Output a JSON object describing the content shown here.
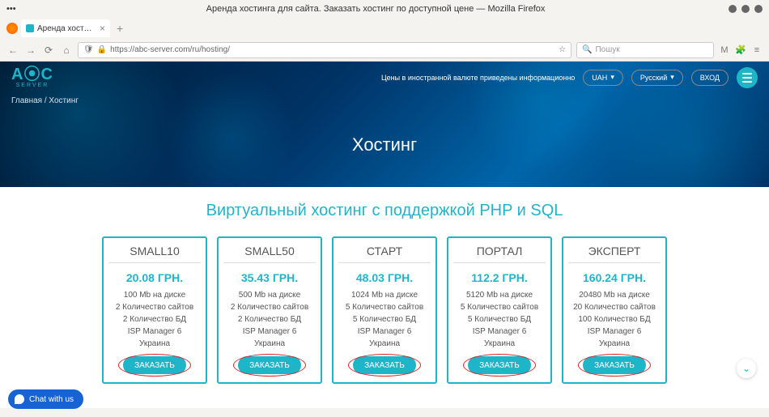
{
  "sys": {
    "title": "Аренда хостинга для сайта. Заказать хостинг по доступной цене — Mozilla Firefox",
    "dots_label": "•••"
  },
  "browser": {
    "tab_title": "Аренда хостинга для сайт",
    "url_display": "https://abc-server.com/ru/hosting/",
    "search_placeholder": "Пошук"
  },
  "site": {
    "logo_main": "A⦿C",
    "logo_sub": "SERVER",
    "info_text": "Цены в иностранной валюте приведены информационно",
    "currency": "UAH",
    "language": "Русский",
    "login_label": "ВХОД"
  },
  "breadcrumb": {
    "home": "Главная",
    "current": "Хостинг",
    "sep": " / "
  },
  "hero_title": "Хостинг",
  "section_title": "Виртуальный хостинг с поддержкой PHP и SQL",
  "order_label": "ЗАКАЗАТЬ",
  "plans": [
    {
      "name": "SMALL10",
      "price": "20.08 ГРН.",
      "specs": [
        "100 Mb на диске",
        "2 Количество сайтов",
        "2 Количество БД",
        "ISP Manager 6",
        "Украина"
      ]
    },
    {
      "name": "SMALL50",
      "price": "35.43 ГРН.",
      "specs": [
        "500 Mb на диске",
        "2 Количество сайтов",
        "2 Количество БД",
        "ISP Manager 6",
        "Украина"
      ]
    },
    {
      "name": "СТАРТ",
      "price": "48.03 ГРН.",
      "specs": [
        "1024 Mb на диске",
        "5 Количество сайтов",
        "5 Количество БД",
        "ISP Manager 6",
        "Украина"
      ]
    },
    {
      "name": "ПОРТАЛ",
      "price": "112.2 ГРН.",
      "specs": [
        "5120 Mb на диске",
        "5 Количество сайтов",
        "5 Количество БД",
        "ISP Manager 6",
        "Украина"
      ]
    },
    {
      "name": "ЭКСПЕРТ",
      "price": "160.24 ГРН.",
      "specs": [
        "20480 Mb на диске",
        "20 Количество сайтов",
        "100 Количество БД",
        "ISP Manager 6",
        "Украина"
      ]
    }
  ],
  "chat_label": "Chat with us"
}
